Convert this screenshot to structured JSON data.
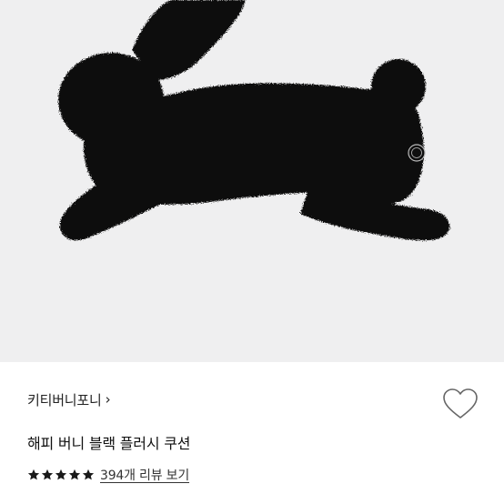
{
  "product": {
    "image_alt_icon": "bunny-cushion-image",
    "brand_label": "키티버니포니",
    "brand_chevron": "›",
    "title": "해피 버니 블랙 플러시 쿠션",
    "rating": 5,
    "rating_max": 5,
    "review_link_text": "394개 리뷰 보기"
  },
  "colors": {
    "image_background": "#efeff0",
    "plush": "#0f0f0f",
    "star": "#1a1a1a",
    "heart_outline": "#666666"
  },
  "icons": {
    "wishlist": "heart-outline-icon",
    "star": "star-icon"
  }
}
